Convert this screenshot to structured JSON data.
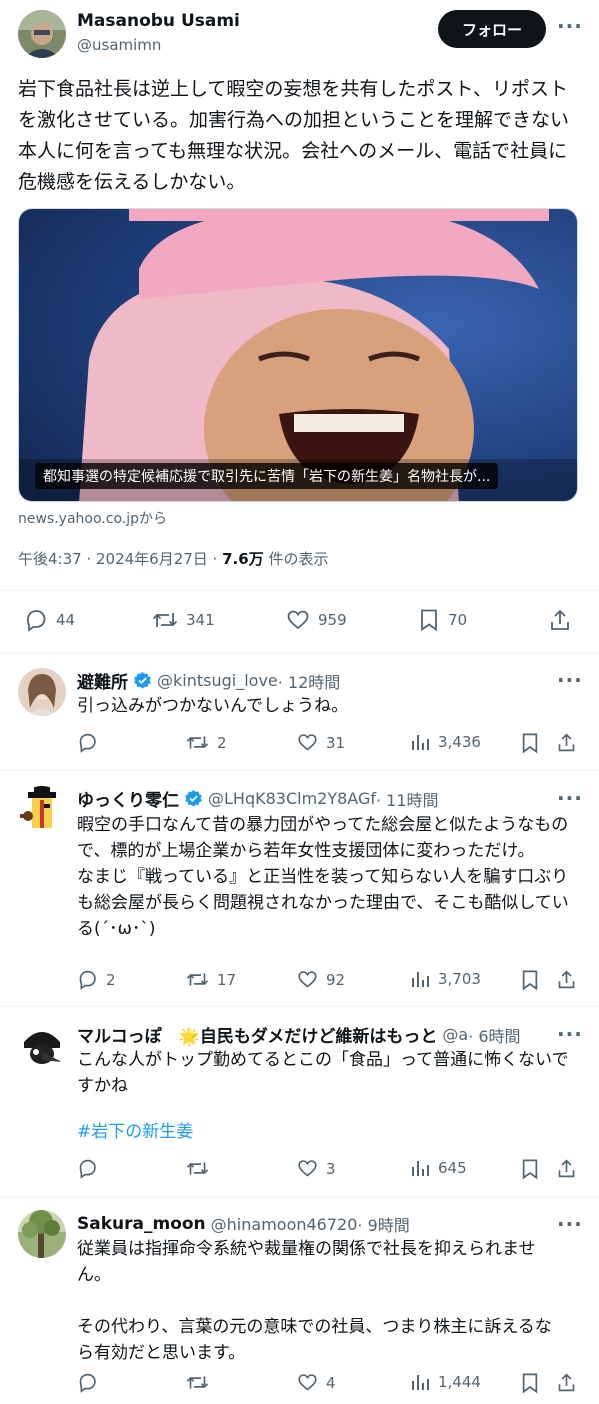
{
  "main_post": {
    "author_name": "Masanobu Usami",
    "author_handle": "@usamimn",
    "follow_label": "フォロー",
    "text": "岩下食品社長は逆上して暇空の妄想を共有したポスト、リポストを激化させている。加害行為への加担ということを理解できない本人に何を言っても無理な状況。会社へのメール、電話で社員に危機感を伝えるしかない。",
    "card_title": "都知事選の特定候補応援で取引先に苦情「岩下の新生姜」名物社長が...",
    "card_source": "news.yahoo.co.jpから",
    "timestamp": "午後4:37 · 2024年6月27日 · ",
    "views_count": "7.6万",
    "views_label": " 件の表示",
    "replies": "44",
    "reposts": "341",
    "likes": "959",
    "bookmarks": "70"
  },
  "replies": [
    {
      "name": "避難所",
      "handle": "@kintsugi_love",
      "time": " · 12時間",
      "text": "引っ込みがつかないんでしょうね。",
      "replies": "",
      "reposts": "2",
      "likes": "31",
      "views": "3,436"
    },
    {
      "name": "ゆっくり零仁",
      "handle": "@LHqK83Clm2Y8AGf",
      "time": " · 11時間",
      "text": "暇空の手口なんて昔の暴力団がやってた総会屋と似たようなもので、標的が上場企業から若年女性支援団体に変わっただけ。\nなまじ『戦っている』と正当性を装って知らない人を騙す口ぶりも総会屋が長らく問題視されなかった理由で、そこも酷似している(´･ω･`)",
      "replies": "2",
      "reposts": "17",
      "likes": "92",
      "views": "3,703"
    },
    {
      "name": "マルコっぽ　🌟自民もダメだけど維新はもっと",
      "handle": "@a",
      "time": " · 6時間",
      "text": "こんな人がトップ勤めてるとこの「食品」って普通に怖くないですかね",
      "hashtag": "#岩下の新生姜",
      "replies": "",
      "reposts": "",
      "likes": "3",
      "views": "645"
    },
    {
      "name": "Sakura_moon",
      "handle": "@hinamoon46720",
      "time": " · 9時間",
      "text": "従業員は指揮命令系統や裁量権の関係で社長を抑えられません。\n\nその代わり、言葉の元の意味での社員、つまり株主に訴えるなら有効だと思います。",
      "replies": "",
      "reposts": "",
      "likes": "4",
      "views": "1,444"
    }
  ],
  "colors": {
    "verified": "#1d9bf0",
    "hashtag": "#1d9bf0",
    "muted": "#536471",
    "follow_bg": "#0f1419"
  },
  "icons": [
    "reply-icon",
    "repost-icon",
    "like-icon",
    "bookmark-icon",
    "share-icon",
    "views-icon",
    "verified-icon",
    "more-icon"
  ]
}
